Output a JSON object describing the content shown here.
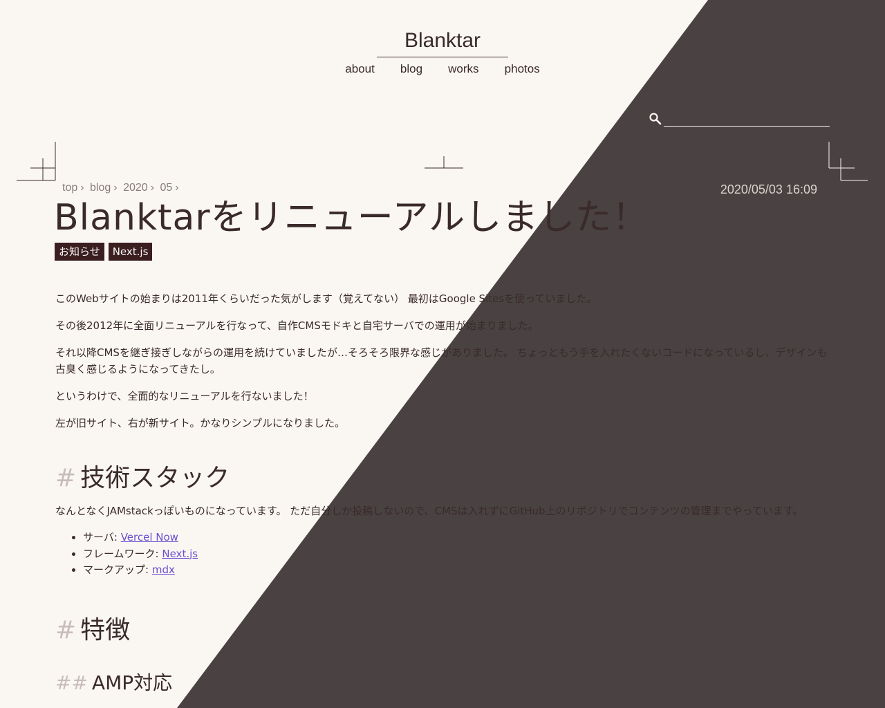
{
  "site": {
    "title": "Blanktar"
  },
  "nav": [
    {
      "label": "about"
    },
    {
      "label": "blog"
    },
    {
      "label": "works"
    },
    {
      "label": "photos"
    }
  ],
  "search": {
    "value": "",
    "placeholder": ""
  },
  "breadcrumb": [
    "top",
    "blog",
    "2020",
    "05"
  ],
  "post": {
    "date": "2020/05/03 16:09",
    "title": "Blanktarをリニューアルしました！",
    "tags": [
      "お知らせ",
      "Next.js"
    ],
    "paragraphs": [
      "このWebサイトの始まりは2011年くらいだった気がします（覚えてない） 最初はGoogle Sitesを使っていました。",
      "その後2012年に全面リニューアルを行なって、自作CMSモドキと自宅サーバでの運用が始まりました。",
      "それ以降CMSを継ぎ接ぎしながらの運用を続けていましたが…そろそろ限界な感じがありました。 ちょっともう手を入れたくないコードになっているし、デザインも古臭く感じるようになってきたし。",
      "というわけで、全面的なリニューアルを行ないました！",
      "左が旧サイト、右が新サイト。かなりシンプルになりました。"
    ],
    "section1": {
      "hash": "#",
      "heading": "技術スタック",
      "text": "なんとなくJAMstackっぽいものになっています。 ただ自分しか投稿しないので、CMSは入れずにGitHub上のリポジトリでコンテンツの管理までやっています。",
      "items": [
        {
          "label": "サーバ: ",
          "link": "Vercel Now"
        },
        {
          "label": "フレームワーク: ",
          "link": "Next.js"
        },
        {
          "label": "マークアップ: ",
          "link": "mdx"
        }
      ]
    },
    "section2": {
      "hash": "#",
      "heading": "特徴"
    },
    "section3": {
      "hash": "##",
      "heading": "AMP対応"
    }
  },
  "colors": {
    "background": "#faf7f3",
    "dark_panel": "#4a4242",
    "text": "#3a2a2a",
    "tag_bg": "#3a1e20",
    "link": "#6a4fd0"
  },
  "icons": {
    "search": "search-icon"
  }
}
